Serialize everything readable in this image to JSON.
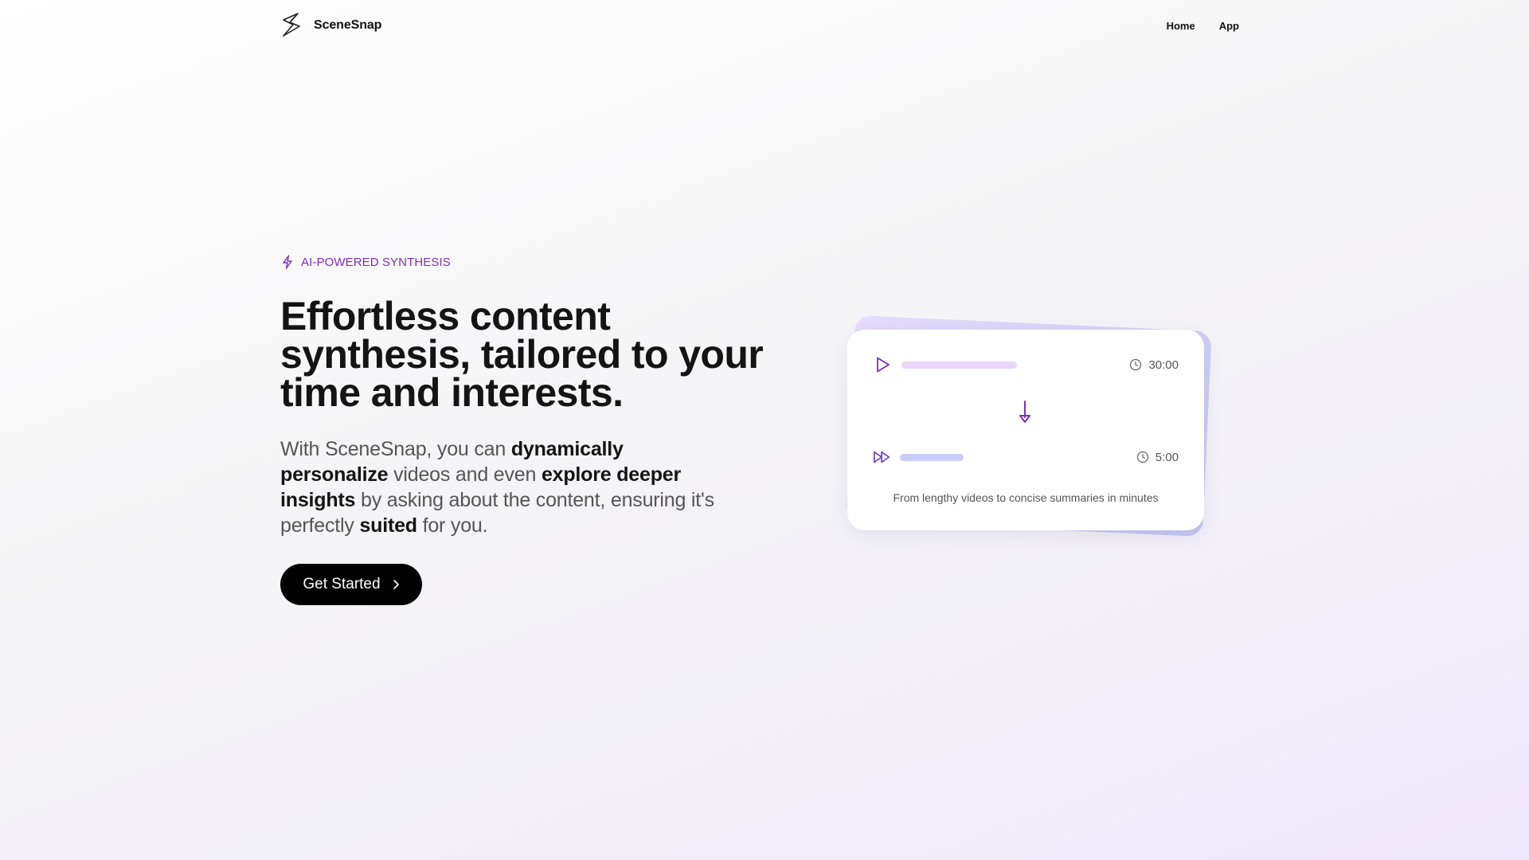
{
  "header": {
    "brand": "SceneSnap",
    "nav": [
      {
        "label": "Home"
      },
      {
        "label": "App"
      }
    ]
  },
  "hero": {
    "badge": "AI-POWERED SYNTHESIS",
    "headline": "Effortless content synthesis, tailored to your time and interests.",
    "subtext": {
      "p1": "With SceneSnap, you can ",
      "b1": "dynamically personalize",
      "p2": " videos and even ",
      "b2": "explore deeper insights",
      "p3": " by asking about the content, ensuring it's perfectly ",
      "b3": "suited",
      "p4": " for you."
    },
    "cta_label": "Get Started"
  },
  "card": {
    "original_duration": "30:00",
    "summary_duration": "5:00",
    "caption": "From lengthy videos to concise summaries in minutes"
  },
  "colors": {
    "accent": "#7b2fbf",
    "bar_long": "#e7d6fa",
    "bar_short": "#c9cdf7",
    "cta_bg": "#000000"
  },
  "icons": [
    "logo-icon",
    "lightning-icon",
    "chevron-right-icon",
    "play-icon",
    "fast-forward-icon",
    "clock-icon",
    "arrow-down-icon"
  ]
}
